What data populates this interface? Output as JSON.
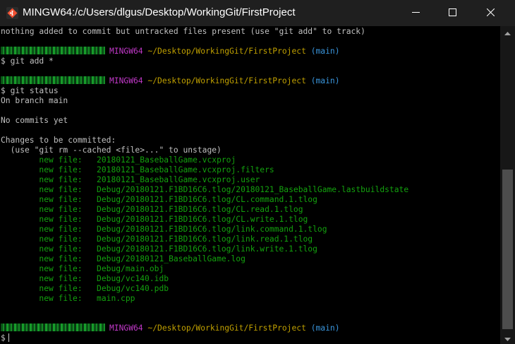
{
  "window": {
    "title": "MINGW64:/c/Users/dlgus/Desktop/WorkingGit/FirstProject",
    "icons": {
      "app": "git-bash-icon",
      "minimize": "minimize-icon",
      "maximize": "maximize-icon",
      "close": "close-icon"
    }
  },
  "colors": {
    "background": "#000000",
    "text": "#c0c0c0",
    "staged_file": "#13a10e",
    "host": "#c239c9",
    "path": "#c0a000",
    "branch": "#3a96dd"
  },
  "terminal": {
    "hint_line": "nothing added to commit but untracked files present (use \"git add\" to track)",
    "prompt": {
      "env": "MINGW64",
      "path": "~/Desktop/WorkingGit/FirstProject",
      "branch": "(main)",
      "symbol": "$"
    },
    "cmd_add": "git add *",
    "cmd_status": "git status",
    "on_branch": "On branch main",
    "no_commits": "No commits yet",
    "changes_header": "Changes to be committed:",
    "unstage_hint": "  (use \"git rm --cached <file>...\" to unstage)",
    "new_file_label": "new file:",
    "staged_files": [
      "20180121_BaseballGame.vcxproj",
      "20180121_BaseballGame.vcxproj.filters",
      "20180121_BaseballGame.vcxproj.user",
      "Debug/20180121.F1BD16C6.tlog/20180121_BaseballGame.lastbuildstate",
      "Debug/20180121.F1BD16C6.tlog/CL.command.1.tlog",
      "Debug/20180121.F1BD16C6.tlog/CL.read.1.tlog",
      "Debug/20180121.F1BD16C6.tlog/CL.write.1.tlog",
      "Debug/20180121.F1BD16C6.tlog/link.command.1.tlog",
      "Debug/20180121.F1BD16C6.tlog/link.read.1.tlog",
      "Debug/20180121.F1BD16C6.tlog/link.write.1.tlog",
      "Debug/20180121_BaseballGame.log",
      "Debug/main.obj",
      "Debug/vc140.idb",
      "Debug/vc140.pdb",
      "main.cpp"
    ]
  }
}
